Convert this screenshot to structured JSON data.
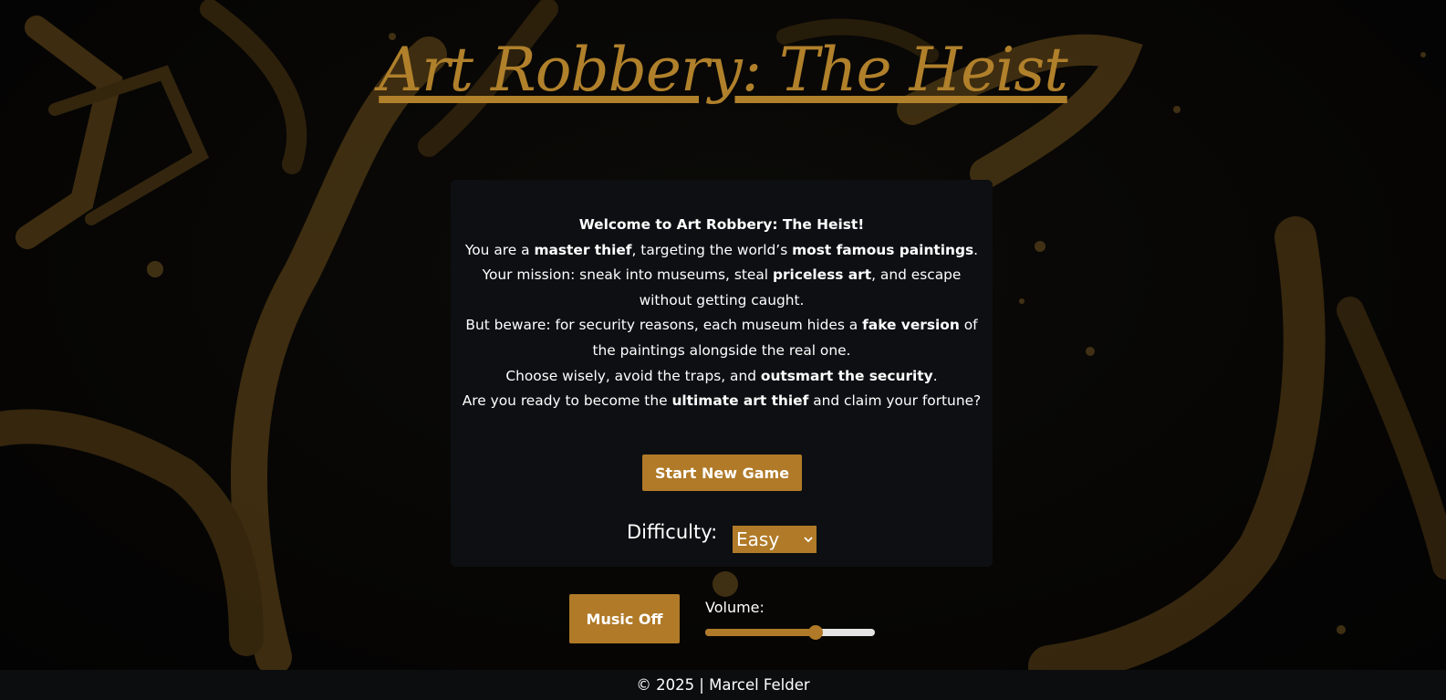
{
  "game": {
    "title": "Art Robbery: The Heist"
  },
  "intro": {
    "heading": "Welcome to Art Robbery: The Heist!",
    "line2": {
      "a": "You are a ",
      "b": "master thief",
      "c": ", targeting the world’s ",
      "d": "most famous paintings",
      "e": "."
    },
    "line3": {
      "a": "Your mission: sneak into museums, steal ",
      "b": "priceless art",
      "c": ", and escape"
    },
    "line4": "without getting caught.",
    "line5": {
      "a": "But beware: for security reasons, each museum hides a ",
      "b": "fake version",
      "c": " of"
    },
    "line6": "the paintings alongside the real one.",
    "line7": {
      "a": "Choose wisely, avoid the traps, and ",
      "b": "outsmart the security",
      "c": "."
    },
    "line8": {
      "a": "Are you ready to become the ",
      "b": "ultimate art thief",
      "c": " and claim your fortune?"
    }
  },
  "controls": {
    "start_label": "Start New Game",
    "difficulty_label": "Difficulty:",
    "difficulty_selected": "Easy",
    "music_label": "Music Off",
    "volume_label": "Volume:",
    "volume_level": 0.65
  },
  "footer": {
    "text": "© 2025 | Marcel Felder"
  },
  "colors": {
    "accent": "#b07a28",
    "panel": "#0d0f12",
    "background": "#050505"
  },
  "icons": {
    "difficulty_dropdown": "chevron-down-icon"
  }
}
